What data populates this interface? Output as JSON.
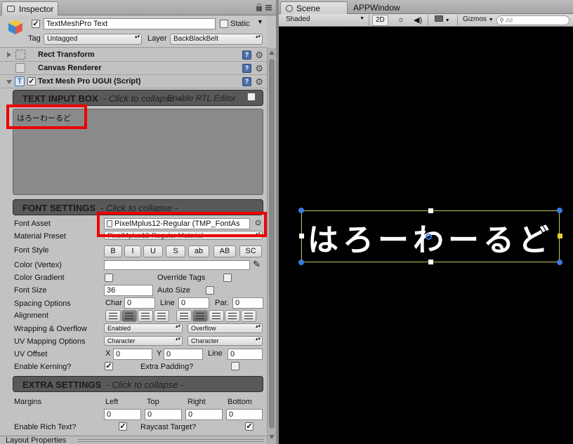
{
  "inspector": {
    "tab_label": "Inspector",
    "object_name": "TextMeshPro Text",
    "static_label": "Static",
    "tag_label": "Tag",
    "tag_value": "Untagged",
    "layer_label": "Layer",
    "layer_value": "BackBlackBelt",
    "components": [
      {
        "title": "Rect Transform"
      },
      {
        "title": "Canvas Renderer"
      },
      {
        "title": "Text Mesh Pro UGUI (Script)"
      }
    ],
    "text_input": {
      "title": "TEXT INPUT BOX",
      "subtitle": "- Click to collapse -",
      "rtl_label": "Enable RTL Editor",
      "text": "はろーわーるど"
    },
    "font_settings": {
      "title": "FONT SETTINGS",
      "subtitle": "- Click to collapse -",
      "font_asset_label": "Font Asset",
      "font_asset_value": "PixelMplus12-Regular (TMP_FontAs",
      "material_label": "Material Preset",
      "material_value": "PixelMplus12-Regular Material",
      "style_label": "Font Style",
      "style_buttons": [
        "B",
        "I",
        "U",
        "S",
        "ab",
        "AB",
        "SC"
      ],
      "color_label": "Color (Vertex)",
      "gradient_label": "Color Gradient",
      "override_label": "Override Tags",
      "size_label": "Font Size",
      "size_value": "36",
      "autosize_label": "Auto Size",
      "spacing_label": "Spacing Options",
      "char_label": "Char",
      "char_value": "0",
      "line_label": "Line",
      "line_value": "0",
      "par_label": "Par.",
      "par_value": "0",
      "alignment_label": "Alignment",
      "wrap_label": "Wrapping & Overflow",
      "wrap_value": "Enabled",
      "overflow_value": "Overflow",
      "uvmap_label": "UV Mapping Options",
      "uvmap_h": "Character",
      "uvmap_v": "Character",
      "uvoffset_label": "UV Offset",
      "uv_x_label": "X",
      "uv_x": "0",
      "uv_y_label": "Y",
      "uv_y": "0",
      "uv_line_label": "Line",
      "uv_line": "0",
      "kerning_label": "Enable Kerning?",
      "padding_label": "Extra Padding?"
    },
    "extra_settings": {
      "title": "EXTRA SETTINGS",
      "subtitle": "- Click to collapse -",
      "margins_label": "Margins",
      "left_label": "Left",
      "top_label": "Top",
      "right_label": "Right",
      "bottom_label": "Bottom",
      "left": "0",
      "top": "0",
      "right": "0",
      "bottom": "0",
      "richtext_label": "Enable Rich Text?",
      "raycast_label": "Raycast Target?"
    },
    "footer_label": "Layout Properties"
  },
  "scene": {
    "tab_label": "Scene",
    "tab2_label": "APPWindow",
    "shading": "Shaded",
    "mode_2d": "2D",
    "gizmos": "Gizmos",
    "search_placeholder": "All",
    "display_text": "はろーわーるど"
  },
  "colors": {
    "highlight": "#ee0000",
    "handle_blue": "#3a7be0",
    "rect_outline": "#c8c85a"
  }
}
